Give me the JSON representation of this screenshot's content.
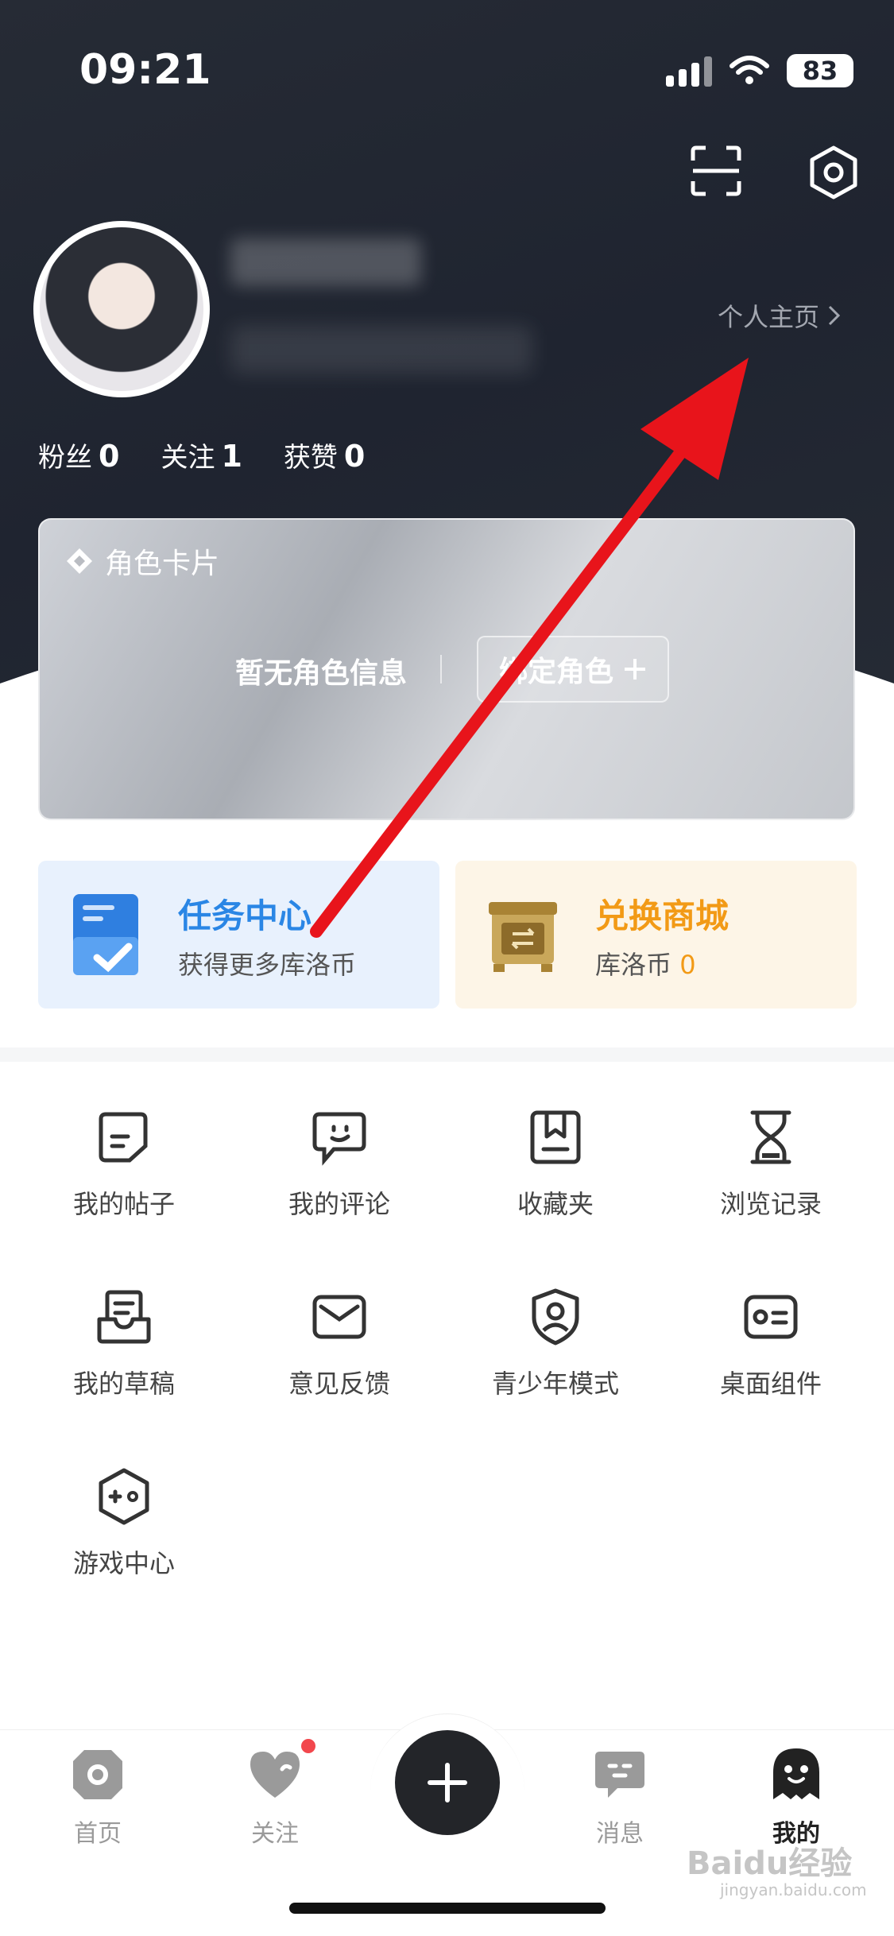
{
  "status_bar": {
    "time": "09:21",
    "battery": "83"
  },
  "profile": {
    "homepage_link": "个人主页"
  },
  "stats": [
    {
      "label": "粉丝",
      "value": "0"
    },
    {
      "label": "关注",
      "value": "1"
    },
    {
      "label": "获赞",
      "value": "0"
    }
  ],
  "role_card": {
    "title": "角色卡片",
    "empty_text": "暂无角色信息",
    "bind_label": "绑定角色"
  },
  "task_center": {
    "title": "任务中心",
    "subtitle": "获得更多库洛币"
  },
  "exchange_shop": {
    "title": "兑换商城",
    "coin_label": "库洛币",
    "coin_value": "0"
  },
  "menu": [
    {
      "label": "我的帖子",
      "icon": "post-icon"
    },
    {
      "label": "我的评论",
      "icon": "comment-icon"
    },
    {
      "label": "收藏夹",
      "icon": "bookmark-icon"
    },
    {
      "label": "浏览记录",
      "icon": "hourglass-icon"
    },
    {
      "label": "我的草稿",
      "icon": "drafts-icon"
    },
    {
      "label": "意见反馈",
      "icon": "mail-icon"
    },
    {
      "label": "青少年模式",
      "icon": "shield-person-icon"
    },
    {
      "label": "桌面组件",
      "icon": "widget-card-icon"
    },
    {
      "label": "游戏中心",
      "icon": "gamepad-icon"
    }
  ],
  "tabs": [
    {
      "label": "首页",
      "icon": "camera-home-icon"
    },
    {
      "label": "关注",
      "icon": "heart-icon"
    },
    {
      "label": "消息",
      "icon": "message-icon"
    },
    {
      "label": "我的",
      "icon": "mascot-icon"
    }
  ],
  "watermark": {
    "text": "Baidu经验",
    "sub": "jingyan.baidu.com"
  },
  "colors": {
    "header_bg": "#1f2430",
    "task_blue": "#2a86e5",
    "shop_orange": "#f29a16",
    "arrow_red": "#e8141b"
  }
}
